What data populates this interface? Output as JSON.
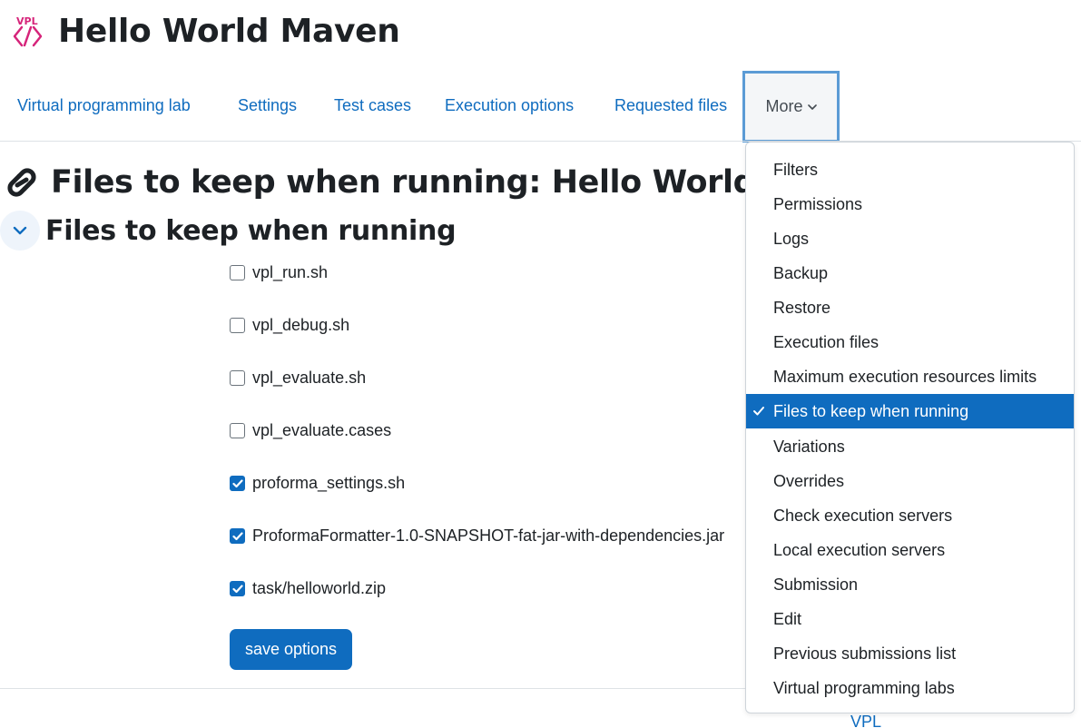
{
  "header": {
    "logo_text": "VPL",
    "title": "Hello World Maven"
  },
  "tabs": [
    {
      "label": "Virtual programming lab"
    },
    {
      "label": "Settings"
    },
    {
      "label": "Test cases"
    },
    {
      "label": "Execution options"
    },
    {
      "label": "Requested files"
    }
  ],
  "more_tab": {
    "label": "More",
    "icon": "chevron-down-icon"
  },
  "page": {
    "heading": "Files to keep when running: Hello World Maven",
    "section_heading": "Files to keep when running"
  },
  "files": [
    {
      "name": "vpl_run.sh",
      "checked": false
    },
    {
      "name": "vpl_debug.sh",
      "checked": false
    },
    {
      "name": "vpl_evaluate.sh",
      "checked": false
    },
    {
      "name": "vpl_evaluate.cases",
      "checked": false
    },
    {
      "name": "proforma_settings.sh",
      "checked": true
    },
    {
      "name": "ProformaFormatter-1.0-SNAPSHOT-fat-jar-with-dependencies.jar",
      "checked": true
    },
    {
      "name": "task/helloworld.zip",
      "checked": true
    }
  ],
  "save_button": "save options",
  "dropdown": {
    "items": [
      {
        "label": "Filters"
      },
      {
        "label": "Permissions"
      },
      {
        "label": "Logs"
      },
      {
        "label": "Backup"
      },
      {
        "label": "Restore"
      },
      {
        "label": "Execution files"
      },
      {
        "label": "Maximum execution resources limits"
      },
      {
        "label": "Files to keep when running",
        "active": true
      },
      {
        "label": "Variations"
      },
      {
        "label": "Overrides"
      },
      {
        "label": "Check execution servers"
      },
      {
        "label": "Local execution servers"
      },
      {
        "label": "Submission"
      },
      {
        "label": "Edit"
      },
      {
        "label": "Previous submissions list"
      },
      {
        "label": "Virtual programming labs"
      }
    ]
  },
  "footer": {
    "link": "VPL"
  },
  "colors": {
    "accent": "#0f6cbf",
    "logo": "#d6247a",
    "focus_border": "#5b9bd5"
  }
}
